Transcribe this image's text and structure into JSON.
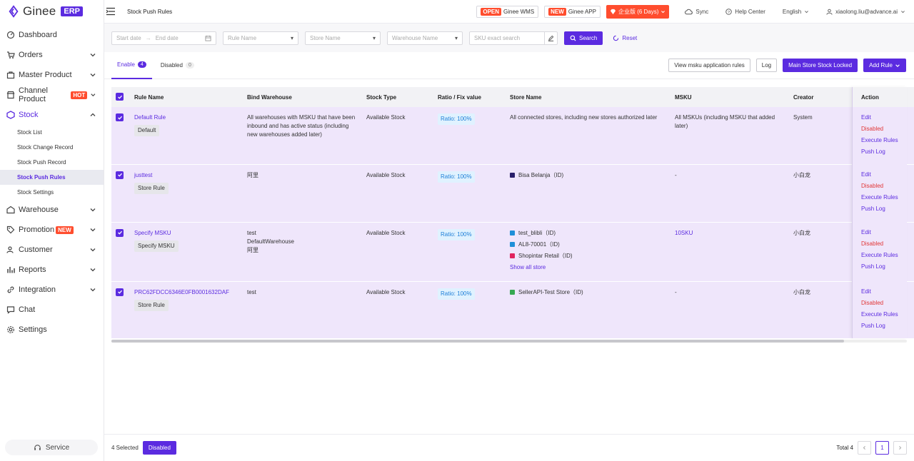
{
  "brand": {
    "name": "Ginee",
    "badge": "ERP",
    "accent": "#5b2be0",
    "danger": "#e13636",
    "hot": "#ff4d2e"
  },
  "sidebar": {
    "items": [
      {
        "label": "Dashboard",
        "icon": "dashboard-icon"
      },
      {
        "label": "Orders",
        "icon": "cart-icon"
      },
      {
        "label": "Master Product",
        "icon": "bag-icon"
      },
      {
        "label": "Channel Product",
        "icon": "store-icon",
        "badge": "HOT"
      },
      {
        "label": "Stock",
        "icon": "stock-icon"
      },
      {
        "label": "Warehouse",
        "icon": "warehouse-icon"
      },
      {
        "label": "Promotion",
        "icon": "promotion-icon",
        "badge": "NEW"
      },
      {
        "label": "Customer",
        "icon": "customer-icon"
      },
      {
        "label": "Reports",
        "icon": "reports-icon"
      },
      {
        "label": "Integration",
        "icon": "link-icon"
      },
      {
        "label": "Chat",
        "icon": "chat-icon"
      },
      {
        "label": "Settings",
        "icon": "gear-icon"
      }
    ],
    "stock_sub": [
      "Stock List",
      "Stock Change Record",
      "Stock Push Record",
      "Stock Push Rules",
      "Stock Settings"
    ],
    "service": "Service"
  },
  "header": {
    "title": "Stock Push Rules",
    "wms_tag": "OPEN",
    "wms_label": "Ginee WMS",
    "app_tag": "NEW",
    "app_label": "Ginee APP",
    "vip_label": "企业版 (6 Days)",
    "sync": "Sync",
    "help": "Help Center",
    "language": "English",
    "user": "xiaolong.liu@advance.ai"
  },
  "filters": {
    "start_date": "Start date",
    "end_date": "End date",
    "rule_name": "Rule Name",
    "store_name": "Store Name",
    "warehouse_name": "Warehouse Name",
    "sku_placeholder": "SKU exact search",
    "search": "Search",
    "reset": "Reset"
  },
  "tabs": [
    {
      "label": "Enable",
      "count": "4"
    },
    {
      "label": "Disabled",
      "count": "0"
    }
  ],
  "actions": {
    "view_msku": "View msku application rules",
    "log": "Log",
    "main_store": "Main Store Stock Locked",
    "add_rule": "Add Rule"
  },
  "table": {
    "headers": [
      "Rule Name",
      "Bind Warehouse",
      "Stock Type",
      "Ratio / Fix value",
      "Store Name",
      "MSKU",
      "Creator",
      "Action"
    ],
    "rows": [
      {
        "name": "Default Rule",
        "tag": "Default",
        "warehouse": [
          "All warehouses with MSKU that have been inbound and has active status (including new warehouses added later)"
        ],
        "stock_type": "Available Stock",
        "ratio": "Ratio: 100%",
        "stores": [],
        "store_text": "All connected stores, including new stores authorized later",
        "msku": "All MSKUs (including MSKU that added later)",
        "creator": "System"
      },
      {
        "name": "justtest",
        "tag": "Store Rule",
        "warehouse": [
          "阿里"
        ],
        "stock_type": "Available Stock",
        "ratio": "Ratio: 100%",
        "stores": [
          {
            "name": "Bisa Belanja（ID)",
            "color": "#2a1f6b"
          }
        ],
        "store_text": "",
        "msku": "-",
        "creator": "小白龙"
      },
      {
        "name": "Specify MSKU",
        "tag": "Specify MSKU",
        "warehouse": [
          "test",
          "DefaultWarehouse",
          "阿里"
        ],
        "stock_type": "Available Stock",
        "ratio": "Ratio: 100%",
        "stores": [
          {
            "name": "test_blibli（ID)",
            "color": "#1f8fd8"
          },
          {
            "name": "AL8-70001（ID)",
            "color": "#1f8fd8"
          },
          {
            "name": "Shopintar Retail（ID)",
            "color": "#e0245e"
          }
        ],
        "show_all": "Show all store",
        "store_text": "",
        "msku": "10SKU",
        "creator": "小白龙"
      },
      {
        "name": "PRC62FDCC6346E0FB0001632DAF",
        "tag": "Store Rule",
        "warehouse": [
          "test"
        ],
        "stock_type": "Available Stock",
        "ratio": "Ratio: 100%",
        "stores": [
          {
            "name": "SellerAPI-Test Store（ID)",
            "color": "#36a852"
          }
        ],
        "store_text": "",
        "msku": "-",
        "creator": "小白龙"
      }
    ],
    "row_actions": [
      "Edit",
      "Disabled",
      "Execute Rules",
      "Push Log"
    ]
  },
  "footer": {
    "selected": "4 Selected",
    "disabled_btn": "Disabled",
    "total": "Total 4",
    "page": "1"
  }
}
